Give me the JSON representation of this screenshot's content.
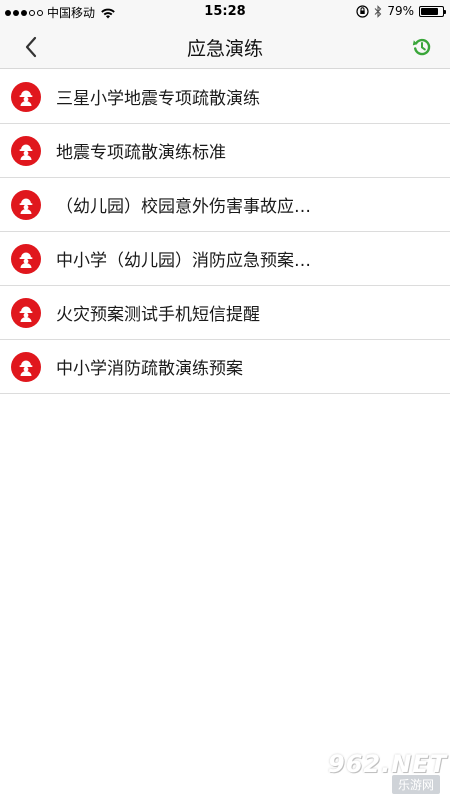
{
  "status_bar": {
    "carrier": "中国移动",
    "time": "15:28",
    "battery": "79%",
    "battery_level": 0.79
  },
  "nav": {
    "title": "应急演练",
    "back_icon": "chevron-left-icon",
    "refresh_icon": "refresh-history-icon",
    "accent_color": "#3aa63a"
  },
  "list": {
    "icon": "firefighter-icon",
    "icon_color": "#e0171d",
    "items": [
      {
        "label": "三星小学地震专项疏散演练"
      },
      {
        "label": "地震专项疏散演练标准"
      },
      {
        "label": "（幼儿园）校园意外伤害事故应…"
      },
      {
        "label": "中小学（幼儿园）消防应急预案…"
      },
      {
        "label": "火灾预案测试手机短信提醒"
      },
      {
        "label": "中小学消防疏散演练预案"
      }
    ]
  },
  "watermark": {
    "main": "962.NET",
    "sub": "乐游网"
  }
}
